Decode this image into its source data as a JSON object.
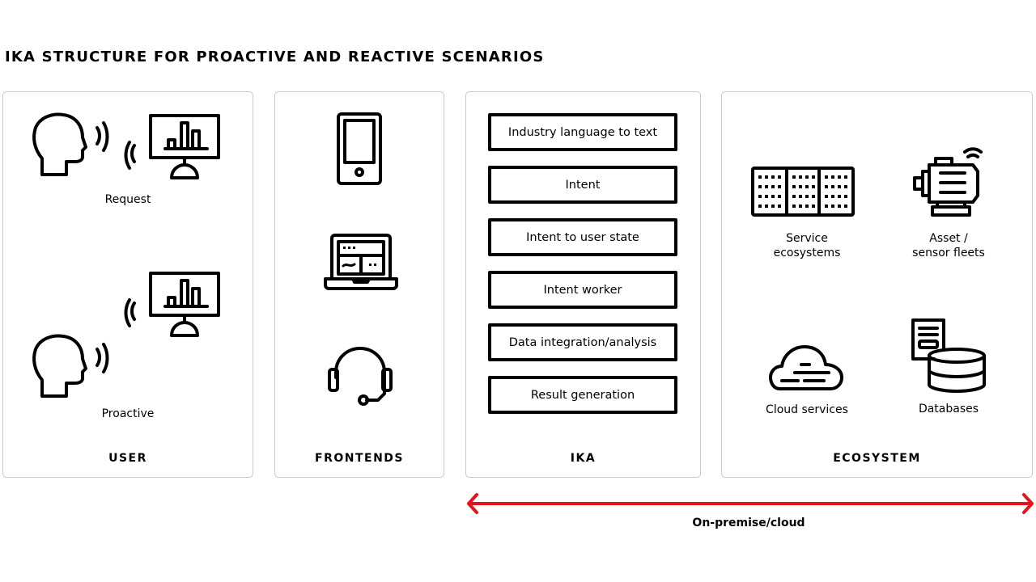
{
  "title": "IKA STRUCTURE FOR PROACTIVE AND REACTIVE SCENARIOS",
  "panels": {
    "user": {
      "label": "USER",
      "scenarios": [
        {
          "label": "Request",
          "icons": [
            "head-speaking-icon",
            "monitor-chart-icon"
          ]
        },
        {
          "label": "Proactive",
          "icons": [
            "monitor-chart-icon",
            "head-speaking-icon"
          ]
        }
      ]
    },
    "frontends": {
      "label": "FRONTENDS",
      "icons": [
        "smartphone-icon",
        "laptop-icon",
        "headset-icon"
      ]
    },
    "ika": {
      "label": "IKA",
      "stages": [
        "Industry language to text",
        "Intent",
        "Intent to user state",
        "Intent worker",
        "Data integration/analysis",
        "Result generation"
      ]
    },
    "ecosystem": {
      "label": "ECOSYSTEM",
      "items": [
        {
          "label_line1": "Service",
          "label_line2": "ecosystems",
          "icon": "server-rack-icon"
        },
        {
          "label_line1": "Asset /",
          "label_line2": "sensor fleets",
          "icon": "motor-sensor-icon"
        },
        {
          "label_line1": "Cloud services",
          "label_line2": "",
          "icon": "cloud-icon"
        },
        {
          "label_line1": "Databases",
          "label_line2": "",
          "icon": "database-icon"
        }
      ]
    }
  },
  "deployment": {
    "label": "On-premise/cloud",
    "arrow_color": "#e3141b"
  }
}
